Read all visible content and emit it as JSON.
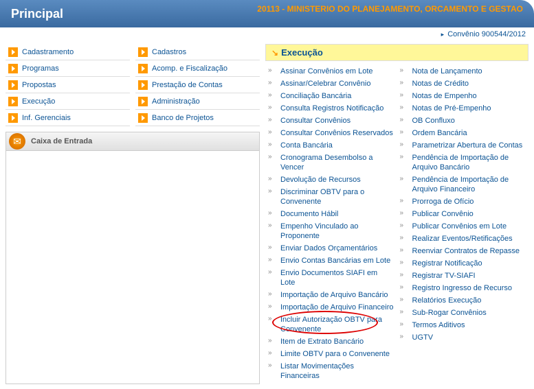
{
  "header": {
    "title": "Principal",
    "org": "20113 - MINISTERIO DO PLANEJAMENTO, ORCAMENTO E GESTAO"
  },
  "breadcrumb": "Convênio 900544/2012",
  "nav": {
    "col1": [
      "Cadastramento",
      "Programas",
      "Propostas",
      "Execução",
      "Inf. Gerenciais"
    ],
    "col2": [
      "Cadastros",
      "Acomp. e Fiscalização",
      "Prestação de Contas",
      "Administração",
      "Banco de Projetos"
    ]
  },
  "inbox_title": "Caixa de Entrada",
  "section_title": "Execução",
  "menu": {
    "col1": [
      "Assinar Convênios em Lote",
      "Assinar/Celebrar Convênio",
      "Conciliação Bancária",
      "Consulta Registros Notificação",
      "Consultar Convênios",
      "Consultar Convênios Reservados",
      "Conta Bancária",
      "Cronograma Desembolso a Vencer",
      "Devolução de Recursos",
      "Discriminar OBTV para o Convenente",
      "Documento Hábil",
      "Empenho Vinculado ao Proponente",
      "Enviar Dados Orçamentários",
      "Envio Contas Bancárias em Lote",
      "Envio Documentos SIAFI em Lote",
      "Importação de Arquivo Bancário",
      "Importação de Arquivo Financeiro",
      "Incluir Autorização OBTV para Convenente",
      "Item de Extrato Bancário",
      "Limite OBTV para o Convenente",
      "Listar Movimentações Financeiras"
    ],
    "col2": [
      "Nota de Lançamento",
      "Notas de Crédito",
      "Notas de Empenho",
      "Notas de Pré-Empenho",
      "OB Confluxo",
      "Ordem Bancária",
      "Parametrizar Abertura de Contas",
      "Pendência de Importação de Arquivo Bancário",
      "Pendência de Importação de Arquivo Financeiro",
      "Prorroga de Ofício",
      "Publicar Convênio",
      "Publicar Convênios em Lote",
      "Realizar Eventos/Retificações",
      "Reenviar Contratos de Repasse",
      "Registrar Notificação",
      "Registrar TV-SIAFI",
      "Registro Ingresso de Recurso",
      "Relatórios Execução",
      "Sub-Rogar Convênios",
      "Termos Aditivos",
      "UGTV"
    ],
    "highlight_col1_index": 17
  }
}
